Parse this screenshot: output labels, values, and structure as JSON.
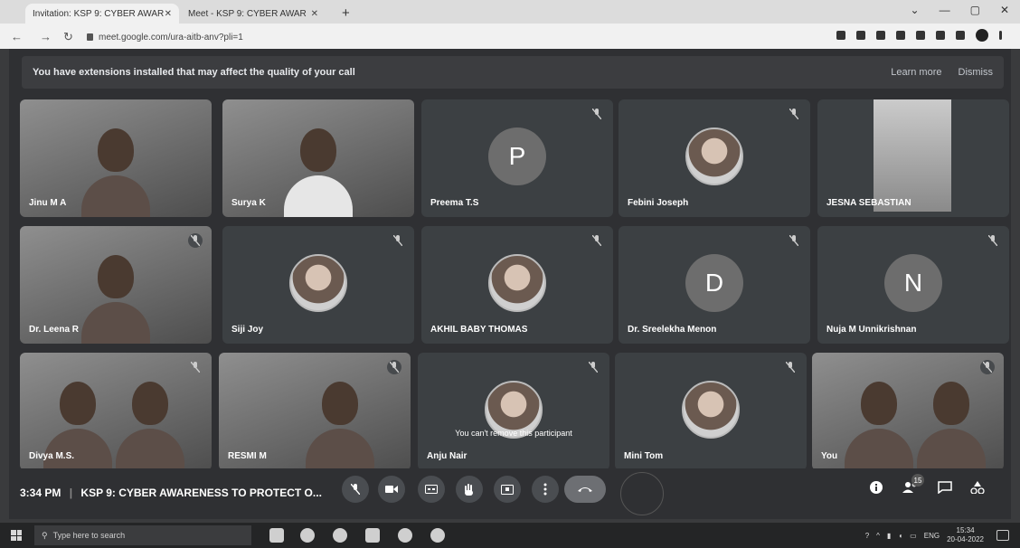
{
  "browser": {
    "tabs": [
      {
        "label": "Invitation: KSP 9: CYBER AWAR",
        "active": true
      },
      {
        "label": "Meet - KSP 9: CYBER AWAR",
        "active": false
      }
    ],
    "url": "meet.google.com/ura-aitb-anv?pli=1"
  },
  "banner": {
    "message": "You have extensions installed that may affect the quality of your call",
    "learn_more": "Learn more",
    "dismiss": "Dismiss"
  },
  "participants": [
    {
      "name": "Jinu M A",
      "kind": "video",
      "muted": false
    },
    {
      "name": "Surya K",
      "kind": "video",
      "muted": false
    },
    {
      "name": "Preema T.S",
      "kind": "letter",
      "letter": "P",
      "muted": true
    },
    {
      "name": "Febini Joseph",
      "kind": "avatar",
      "muted": true
    },
    {
      "name": "JESNA SEBASTIAN",
      "kind": "pip",
      "muted": false
    },
    {
      "name": "Dr. Leena R",
      "kind": "video",
      "muted": true
    },
    {
      "name": "Siji Joy",
      "kind": "avatar",
      "muted": true
    },
    {
      "name": "AKHIL BABY THOMAS",
      "kind": "avatar",
      "muted": true
    },
    {
      "name": "Dr. Sreelekha Menon",
      "kind": "letter",
      "letter": "D",
      "muted": true
    },
    {
      "name": "Nuja M Unnikrishnan",
      "kind": "letter",
      "letter": "N",
      "muted": true
    },
    {
      "name": "Divya M.S.",
      "kind": "video",
      "muted": true
    },
    {
      "name": "RESMI M",
      "kind": "video",
      "muted": true
    },
    {
      "name": "Anju Nair",
      "kind": "avatar",
      "muted": true,
      "note": "You can't remove this participant"
    },
    {
      "name": "Mini Tom",
      "kind": "avatar",
      "muted": true
    },
    {
      "name": "You",
      "kind": "video",
      "muted": true
    }
  ],
  "meeting": {
    "time": "3:34 PM",
    "separator": "|",
    "title": "KSP 9: CYBER AWARENESS TO PROTECT O..."
  },
  "people_count": "15",
  "taskbar": {
    "search_placeholder": "Type here to search",
    "lang": "ENG",
    "clock_time": "15:34",
    "clock_date": "20-04-2022"
  },
  "icons": [
    "mic-off-icon",
    "camera-icon",
    "captions-icon",
    "raise-hand-icon",
    "present-icon",
    "more-icon",
    "end-call-icon",
    "info-icon",
    "people-icon",
    "chat-icon",
    "activities-icon"
  ],
  "colors": {
    "meet_bg": "#2f3033",
    "tile_bg": "#3c4043",
    "end_call": "#6d6f73"
  }
}
